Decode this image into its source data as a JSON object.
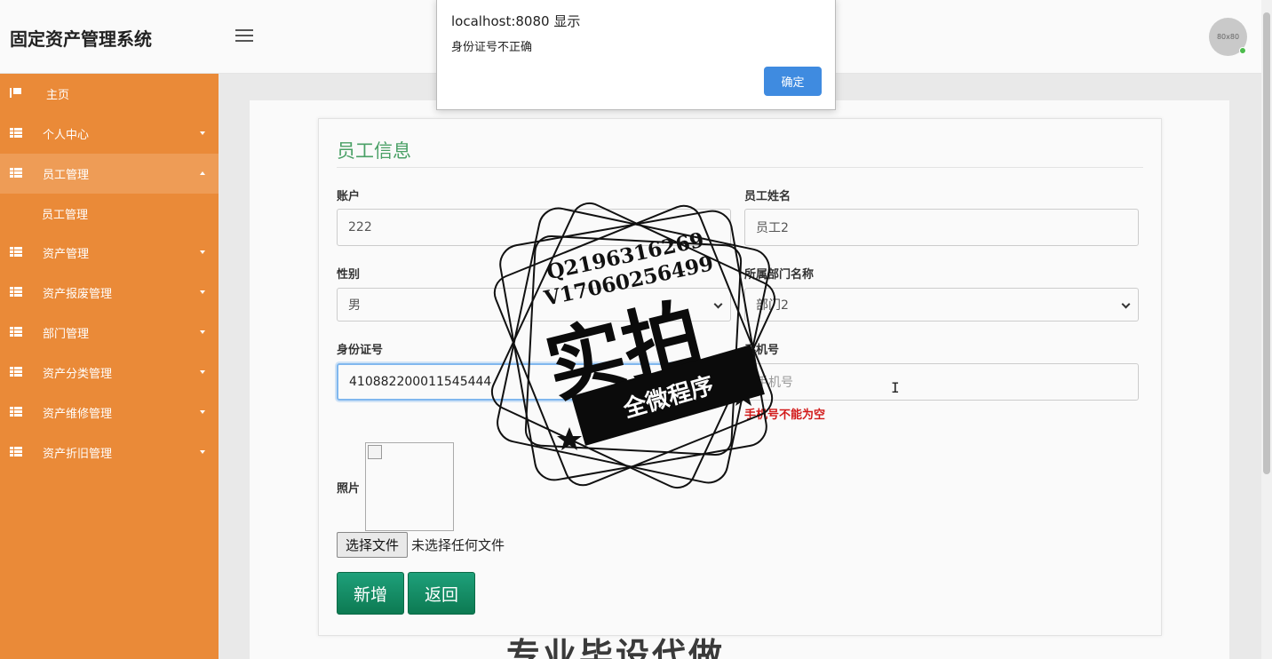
{
  "app": {
    "title": "固定资产管理系统",
    "avatar_text": "80x80"
  },
  "sidebar": {
    "items": [
      {
        "label": "主页",
        "icon": "flag-icon",
        "expandable": false
      },
      {
        "label": "个人中心",
        "icon": "grid-icon",
        "expandable": true
      },
      {
        "label": "员工管理",
        "icon": "grid-icon",
        "expandable": true,
        "expanded": true
      },
      {
        "label": "资产管理",
        "icon": "grid-icon",
        "expandable": true
      },
      {
        "label": "资产报废管理",
        "icon": "grid-icon",
        "expandable": true
      },
      {
        "label": "部门管理",
        "icon": "grid-icon",
        "expandable": true
      },
      {
        "label": "资产分类管理",
        "icon": "grid-icon",
        "expandable": true
      },
      {
        "label": "资产维修管理",
        "icon": "grid-icon",
        "expandable": true
      },
      {
        "label": "资产折旧管理",
        "icon": "grid-icon",
        "expandable": true
      }
    ],
    "sub_items": {
      "员工管理": [
        "员工管理"
      ]
    },
    "colors": {
      "background": "#ea8a38",
      "active": "#ee9c56"
    }
  },
  "form": {
    "title": "员工信息",
    "account": {
      "label": "账户",
      "value": "222"
    },
    "name": {
      "label": "员工姓名",
      "value": "员工2"
    },
    "gender": {
      "label": "性别",
      "value": "男"
    },
    "department": {
      "label": "所属部门名称",
      "value": "部门2"
    },
    "id_card": {
      "label": "身份证号",
      "value": "410882200011545444"
    },
    "phone": {
      "label": "手机号",
      "value": "",
      "placeholder": "手机号",
      "error": "手机号不能为空"
    },
    "photo": {
      "label": "照片",
      "choose_file": "选择文件",
      "no_file": "未选择任何文件"
    },
    "buttons": {
      "add": "新增",
      "back": "返回"
    },
    "colors": {
      "title": "#4aa066",
      "button": "#13906a",
      "error": "#d21a1a"
    }
  },
  "dialog": {
    "title": "localhost:8080 显示",
    "message": "身份证号不正确",
    "ok": "确定"
  },
  "watermark": {
    "line1": "Q2196316269",
    "line2": "V17060256499",
    "big": "实拍",
    "band": "全微程序",
    "bottom": "专业毕设代做"
  }
}
